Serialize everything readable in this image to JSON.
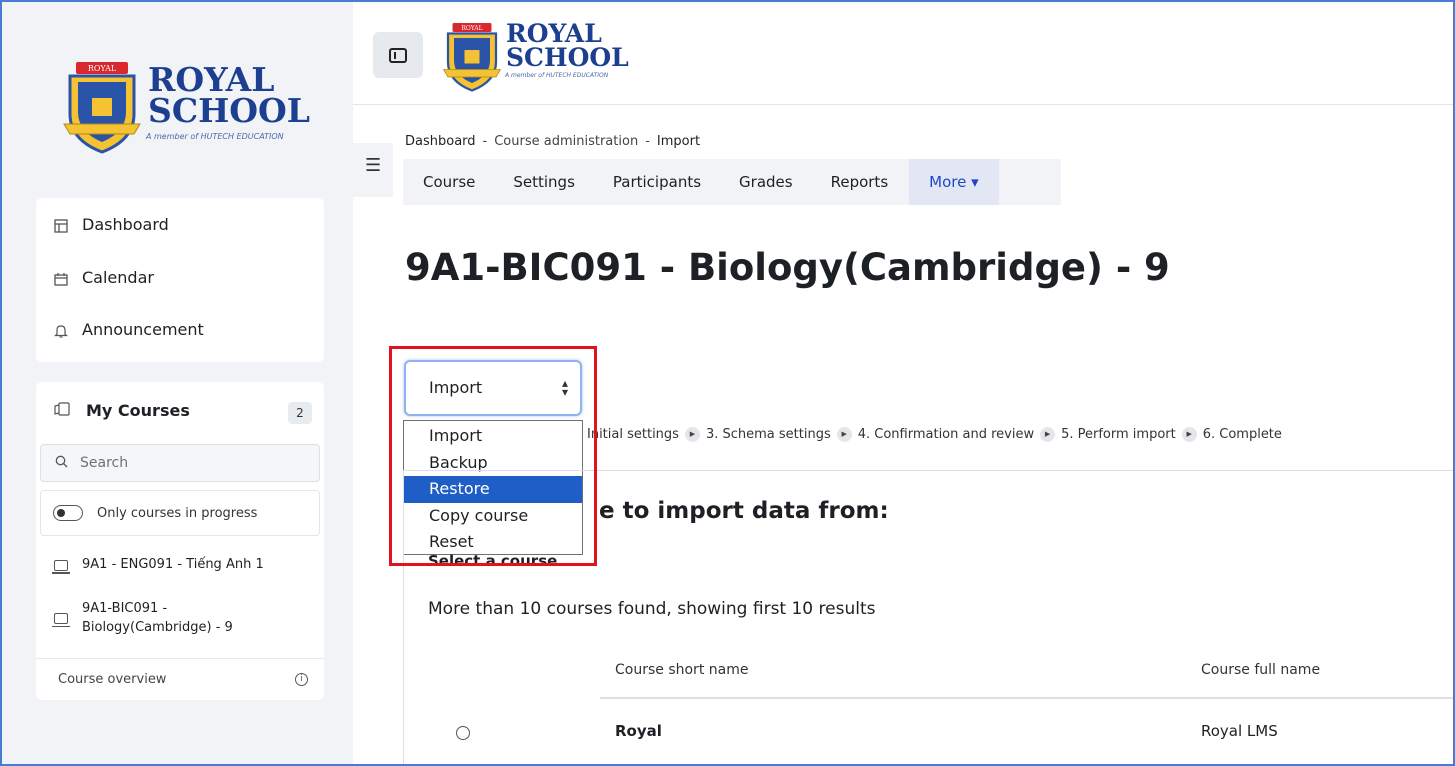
{
  "brand": {
    "line1": "ROYAL",
    "line2": "SCHOOL",
    "tagline": "A member of HUTECH EDUCATION",
    "ribbon": "ROYAL"
  },
  "sidebar": {
    "nav": [
      {
        "label": "Dashboard",
        "icon": "dashboard-icon"
      },
      {
        "label": "Calendar",
        "icon": "calendar-icon"
      },
      {
        "label": "Announcement",
        "icon": "bell-icon"
      }
    ],
    "my_courses": {
      "title": "My Courses",
      "count": "2",
      "search_placeholder": "Search",
      "filter_label": "Only courses in progress",
      "courses": [
        {
          "label": "9A1 - ENG091 - Tiếng Anh 1"
        },
        {
          "label": "9A1-BIC091 -\nBiology(Cambridge) - 9"
        }
      ],
      "footer_label": "Course overview"
    }
  },
  "breadcrumb": [
    "Dashboard",
    "-",
    "Course administration",
    "-",
    "Import"
  ],
  "secondary_nav": {
    "tabs": [
      "Course",
      "Settings",
      "Participants",
      "Grades",
      "Reports"
    ],
    "more_label": "More ▾"
  },
  "page_title": "9A1-BIC091 - Biology(Cambridge) - 9",
  "action_select": {
    "selected": "Import",
    "options": [
      "Import",
      "Backup",
      "Restore",
      "Copy course",
      "Reset"
    ],
    "highlighted": "Restore"
  },
  "steps": [
    "Initial settings",
    "3. Schema settings",
    "4. Confirmation and review",
    "5. Perform import",
    "6. Complete"
  ],
  "section_heading": "e to import data from:",
  "select_label": "Select a course",
  "results_text": "More than 10 courses found, showing first 10 results",
  "table": {
    "headers": [
      "Course short name",
      "Course full name"
    ],
    "rows": [
      {
        "short": "Royal",
        "full": "Royal LMS"
      }
    ]
  },
  "colors": {
    "accent": "#1f48c7",
    "highlight": "#1f5ec6",
    "annotation": "#e0141a",
    "brand": "#1c3f8f"
  }
}
